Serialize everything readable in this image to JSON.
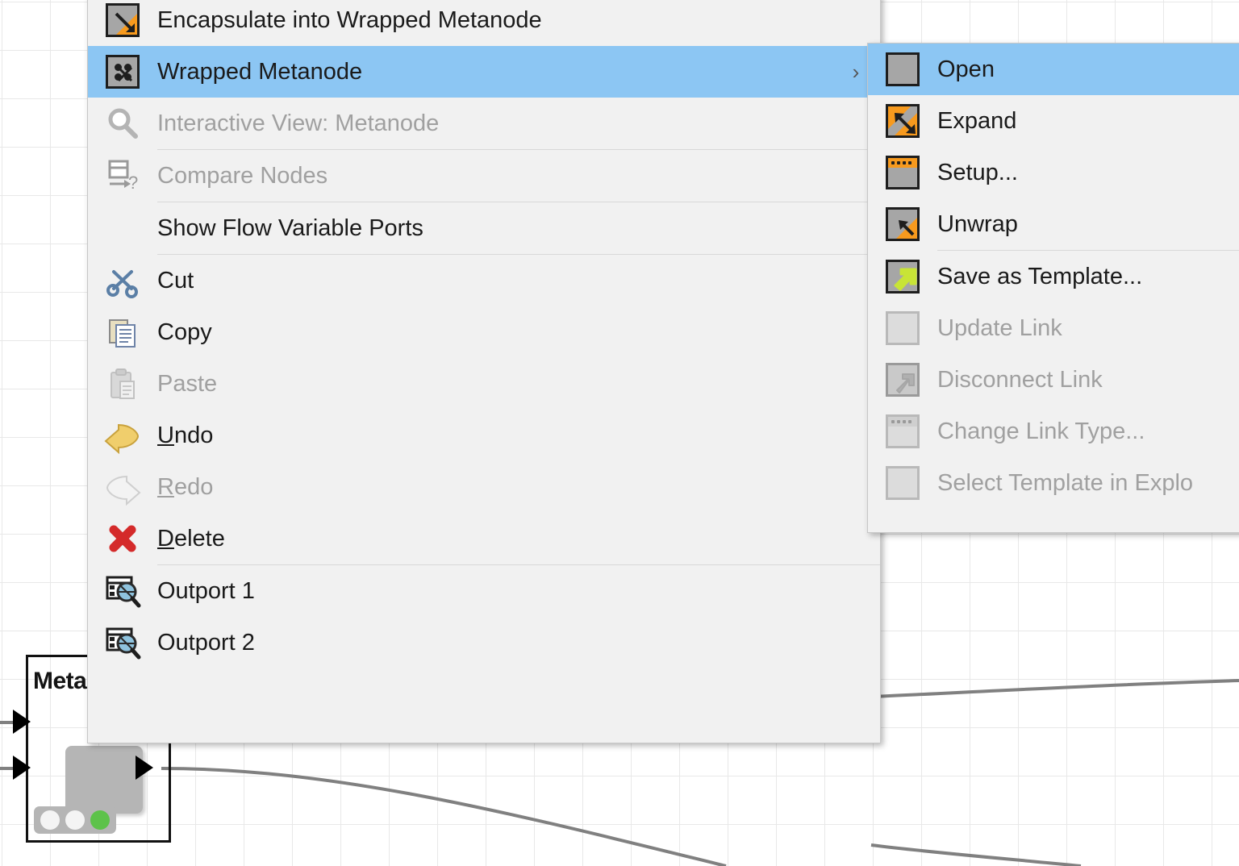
{
  "canvas": {
    "grid_color": "#e8e8e8",
    "background": "#ffffff",
    "wire_color": "#808080"
  },
  "metanode": {
    "name": "Meta",
    "title_truncated": "Meta",
    "in_ports": 2,
    "out_ports": 1,
    "status_leds": [
      "off",
      "off",
      "on"
    ],
    "led_on_color": "#5dc24a"
  },
  "context_menu": {
    "highlight_color": "#8cc6f3",
    "background": "#f1f1f1",
    "items": [
      {
        "id": "encapsulate-into-wrapped-metanode",
        "label": "Encapsulate into Wrapped Metanode",
        "icon": "encapsulate-icon",
        "enabled": true,
        "selected": false,
        "submenu": false,
        "separator_after": false
      },
      {
        "id": "wrapped-metanode",
        "label": "Wrapped Metanode",
        "icon": "wrapped-metanode-icon",
        "enabled": true,
        "selected": true,
        "submenu": true,
        "submenu_arrow": "›",
        "separator_after": false
      },
      {
        "id": "interactive-view-metanode",
        "label": "Interactive View: Metanode",
        "icon": "magnifier-icon",
        "enabled": false,
        "selected": false,
        "submenu": false,
        "separator_after": true
      },
      {
        "id": "compare-nodes",
        "label": "Compare Nodes",
        "icon": "compare-nodes-icon",
        "enabled": false,
        "selected": false,
        "submenu": false,
        "separator_after": true
      },
      {
        "id": "show-flow-variable-ports",
        "label": "Show Flow Variable Ports",
        "icon": "none",
        "enabled": true,
        "selected": false,
        "submenu": false,
        "separator_after": true
      },
      {
        "id": "cut",
        "label": "Cut",
        "icon": "scissors-icon",
        "enabled": true,
        "selected": false,
        "submenu": false,
        "separator_after": false
      },
      {
        "id": "copy",
        "label": "Copy",
        "icon": "copy-icon",
        "enabled": true,
        "selected": false,
        "submenu": false,
        "separator_after": false
      },
      {
        "id": "paste",
        "label": "Paste",
        "icon": "clipboard-icon",
        "enabled": false,
        "selected": false,
        "submenu": false,
        "separator_after": false
      },
      {
        "id": "undo",
        "label": "Undo",
        "accel": "U",
        "icon": "undo-arrow-icon",
        "enabled": true,
        "selected": false,
        "submenu": false,
        "separator_after": false
      },
      {
        "id": "redo",
        "label": "Redo",
        "accel": "R",
        "icon": "redo-arrow-icon",
        "enabled": false,
        "selected": false,
        "submenu": false,
        "separator_after": false
      },
      {
        "id": "delete",
        "label": "Delete",
        "accel": "D",
        "icon": "red-x-icon",
        "enabled": true,
        "selected": false,
        "submenu": false,
        "separator_after": true
      },
      {
        "id": "outport-1",
        "label": "Outport 1",
        "icon": "table-magnifier-icon",
        "enabled": true,
        "selected": false,
        "submenu": false,
        "separator_after": false
      },
      {
        "id": "outport-2",
        "label": "Outport 2",
        "icon": "table-magnifier-icon",
        "enabled": true,
        "selected": false,
        "submenu": false,
        "separator_after": false
      }
    ]
  },
  "submenu": {
    "parent": "wrapped-metanode",
    "highlight_color": "#8cc6f3",
    "items": [
      {
        "id": "open",
        "label": "Open",
        "icon": "plain-square-icon",
        "enabled": true,
        "selected": true,
        "separator_after": false
      },
      {
        "id": "expand",
        "label": "Expand",
        "icon": "expand-icon",
        "enabled": true,
        "selected": false,
        "separator_after": false
      },
      {
        "id": "setup",
        "label": "Setup...",
        "icon": "setup-icon",
        "enabled": true,
        "selected": false,
        "separator_after": false
      },
      {
        "id": "unwrap",
        "label": "Unwrap",
        "icon": "unwrap-icon",
        "enabled": true,
        "selected": false,
        "separator_after": true
      },
      {
        "id": "save-as-template",
        "label": "Save as Template...",
        "icon": "save-template-icon",
        "enabled": true,
        "selected": false,
        "separator_after": false
      },
      {
        "id": "update-link",
        "label": "Update Link",
        "icon": "update-link-icon",
        "enabled": false,
        "selected": false,
        "separator_after": false
      },
      {
        "id": "disconnect-link",
        "label": "Disconnect Link",
        "icon": "disconnect-link-icon",
        "enabled": false,
        "selected": false,
        "separator_after": false
      },
      {
        "id": "change-link-type",
        "label": "Change Link Type...",
        "icon": "change-link-type-icon",
        "enabled": false,
        "selected": false,
        "separator_after": false
      },
      {
        "id": "select-template-in-explorer",
        "label": "Select Template in Explo",
        "icon": "select-template-icon",
        "enabled": false,
        "selected": false,
        "separator_after": false
      }
    ]
  }
}
